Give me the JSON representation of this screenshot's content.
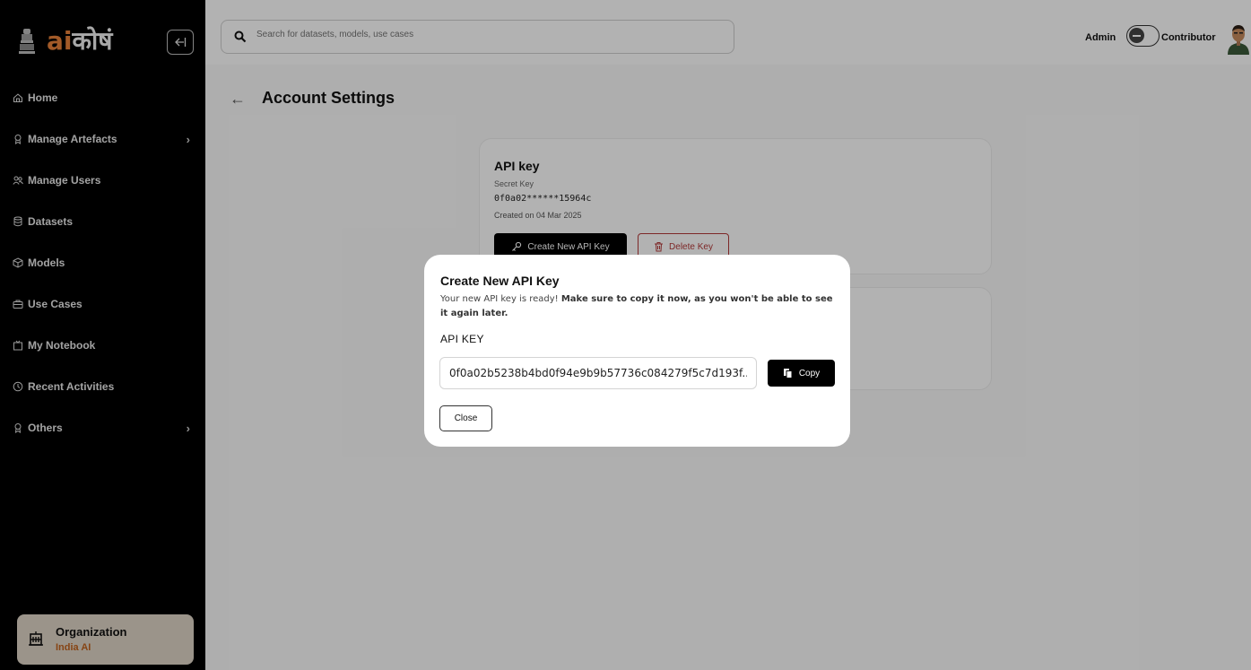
{
  "brand": {
    "logo_ai": "ai",
    "logo_hindi": "कोषं"
  },
  "sidebar": {
    "items": [
      {
        "label": "Home",
        "icon": "home-icon",
        "has_chevron": false
      },
      {
        "label": "Manage Artefacts",
        "icon": "artefacts-icon",
        "has_chevron": true
      },
      {
        "label": "Manage Users",
        "icon": "users-icon",
        "has_chevron": false
      },
      {
        "label": "Datasets",
        "icon": "database-icon",
        "has_chevron": false
      },
      {
        "label": "Models",
        "icon": "cube-icon",
        "has_chevron": false
      },
      {
        "label": "Use Cases",
        "icon": "briefcase-icon",
        "has_chevron": false
      },
      {
        "label": "My Notebook",
        "icon": "notebook-icon",
        "has_chevron": false
      },
      {
        "label": "Recent Activities",
        "icon": "clock-icon",
        "has_chevron": false
      },
      {
        "label": "Others",
        "icon": "others-icon",
        "has_chevron": true
      }
    ],
    "org": {
      "title": "Organization",
      "subtitle": "India AI"
    }
  },
  "header": {
    "search_placeholder": "Search for datasets, models, use cases",
    "role_left": "Admin",
    "role_right": "Contributor"
  },
  "page": {
    "title": "Account Settings",
    "api_card": {
      "title": "API key",
      "secret_label": "Secret Key",
      "secret_value": "0f0a02******15964c",
      "created": "Created on 04 Mar 2025",
      "create_label": "Create New API Key",
      "delete_label": "Delete Key"
    }
  },
  "modal": {
    "title": "Create New API Key",
    "desc_plain": "Your new API key is ready! ",
    "desc_bold": "Make sure to copy it now, as you won't be able to see it again later.",
    "field_label": "API KEY",
    "key_value": "0f0a02b5238b4bd0f94e9b9b57736c084279f5c7d193f...",
    "copy_label": "Copy",
    "close_label": "Close"
  },
  "colors": {
    "sidebar_bg": "#000000",
    "brand_orange": "#e8823a",
    "org_card_bg": "#ded5c6",
    "org_subtitle": "#c0621d",
    "danger": "#b43a3a"
  }
}
